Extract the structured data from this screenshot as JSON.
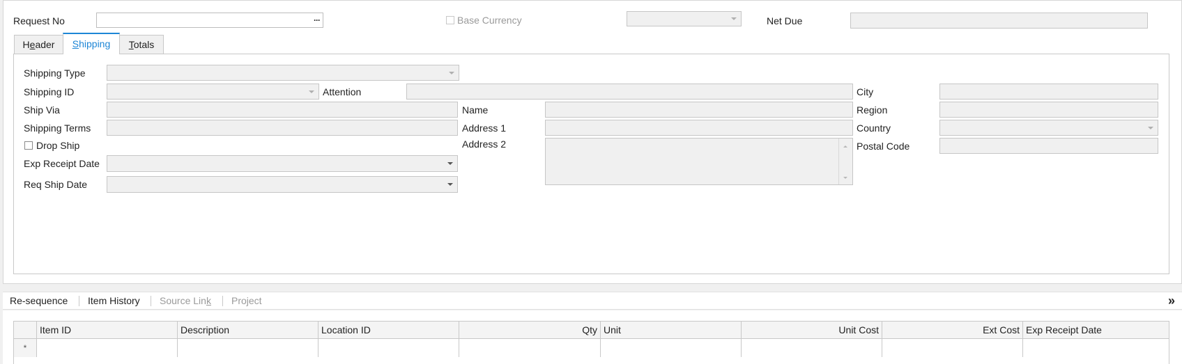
{
  "top": {
    "request_no_label": "Request No",
    "base_currency_label": "Base Currency",
    "net_due_label": "Net Due",
    "ellipsis": "···"
  },
  "tabs": {
    "header": {
      "pre": "H",
      "u": "e",
      "post": "ader"
    },
    "shipping": {
      "pre": "",
      "u": "S",
      "post": "hipping"
    },
    "totals": {
      "pre": "",
      "u": "T",
      "post": "otals"
    }
  },
  "form": {
    "shipping_type": "Shipping Type",
    "shipping_id": "Shipping ID",
    "ship_via": "Ship Via",
    "shipping_terms": "Shipping Terms",
    "drop_ship": "Drop Ship",
    "exp_receipt_date": "Exp Receipt Date",
    "req_ship_date": "Req Ship Date",
    "attention": "Attention",
    "name": "Name",
    "address1": "Address 1",
    "address2": "Address 2",
    "city": "City",
    "region": "Region",
    "country": "Country",
    "postal_code": "Postal Code"
  },
  "toolbar": {
    "resequence": "Re-sequence",
    "item_history": "Item History",
    "source_link_pre": "Source Lin",
    "source_link_u": "k",
    "project": "Project",
    "expand": "»"
  },
  "grid": {
    "columns": [
      "Item ID",
      "Description",
      "Location ID",
      "Qty",
      "Unit",
      "Unit Cost",
      "Ext Cost",
      "Exp Receipt Date"
    ],
    "new_row_marker": "*"
  }
}
